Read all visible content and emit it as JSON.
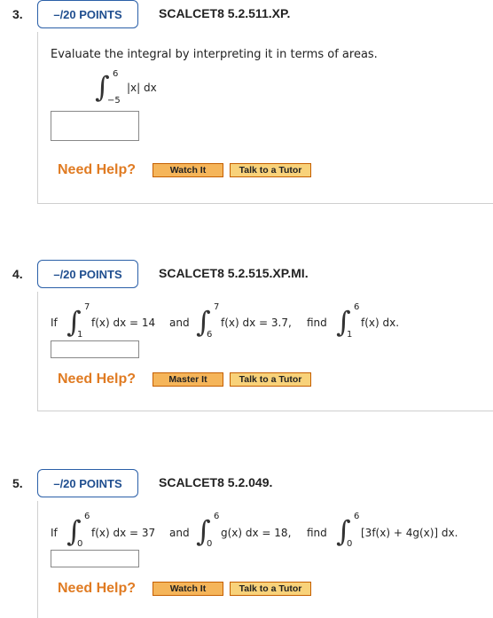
{
  "questions": [
    {
      "number": "3.",
      "points": "–/20 POINTS",
      "code": "SCALCET8 5.2.511.XP.",
      "prompt": "Evaluate the integral by interpreting it in terms of areas.",
      "integral": {
        "upper": "6",
        "lower": "−5",
        "integrand": "|x| dx"
      },
      "need_help": "Need Help?",
      "help_button": "Watch It",
      "tutor_button": "Talk to a Tutor"
    },
    {
      "number": "4.",
      "points": "–/20 POINTS",
      "code": "SCALCET8 5.2.515.XP.MI.",
      "lead": "If",
      "int1": {
        "upper": "7",
        "lower": "1",
        "integrand": "f(x) dx = 14"
      },
      "and": "and",
      "int2": {
        "upper": "7",
        "lower": "6",
        "integrand": "f(x) dx = 3.7,"
      },
      "find": "find",
      "int3": {
        "upper": "6",
        "lower": "1",
        "integrand": "f(x) dx."
      },
      "need_help": "Need Help?",
      "help_button": "Master It",
      "tutor_button": "Talk to a Tutor"
    },
    {
      "number": "5.",
      "points": "–/20 POINTS",
      "code": "SCALCET8 5.2.049.",
      "lead": "If",
      "int1": {
        "upper": "6",
        "lower": "0",
        "integrand": "f(x) dx = 37"
      },
      "and": "and",
      "int2": {
        "upper": "6",
        "lower": "0",
        "integrand": "g(x) dx = 18,"
      },
      "find": "find",
      "int3": {
        "upper": "6",
        "lower": "0",
        "integrand": "[3f(x) + 4g(x)] dx."
      },
      "need_help": "Need Help?",
      "help_button": "Watch It",
      "tutor_button": "Talk to a Tutor"
    }
  ]
}
